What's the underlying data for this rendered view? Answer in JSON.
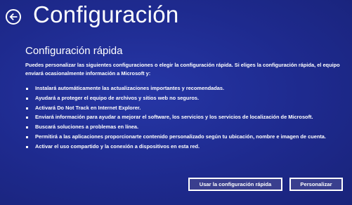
{
  "header": {
    "title": "Configuración"
  },
  "section": {
    "title": "Configuración rápida",
    "intro": "Puedes personalizar las siguientes configuraciones o elegir la configuración rápida. Si eliges la configuración rápida, el equipo enviará ocasionalmente información a Microsoft y:"
  },
  "bullets": [
    "Instalará automáticamente las actualizaciones importantes y recomendadas.",
    "Ayudará a proteger el equipo de archivos y sitios web no seguros.",
    "Activará Do Not Track en Internet Explorer.",
    "Enviará información para ayudar a mejorar el software, los servicios y los servicios de localización de Microsoft.",
    "Buscará soluciones a problemas en línea.",
    "Permitirá a las aplicaciones proporcionarte contenido personalizado según tu ubicación, nombre e imagen de cuenta.",
    "Activar el uso compartido y la conexión a dispositivos en esta red."
  ],
  "buttons": {
    "quick_label": "Usar la configuración rápida",
    "custom_label": "Personalizar"
  },
  "icons": {
    "back": "back-arrow-icon"
  },
  "colors": {
    "background": "#1f2a8a",
    "text": "#ffffff",
    "button_fill": "#3a3f8e"
  }
}
